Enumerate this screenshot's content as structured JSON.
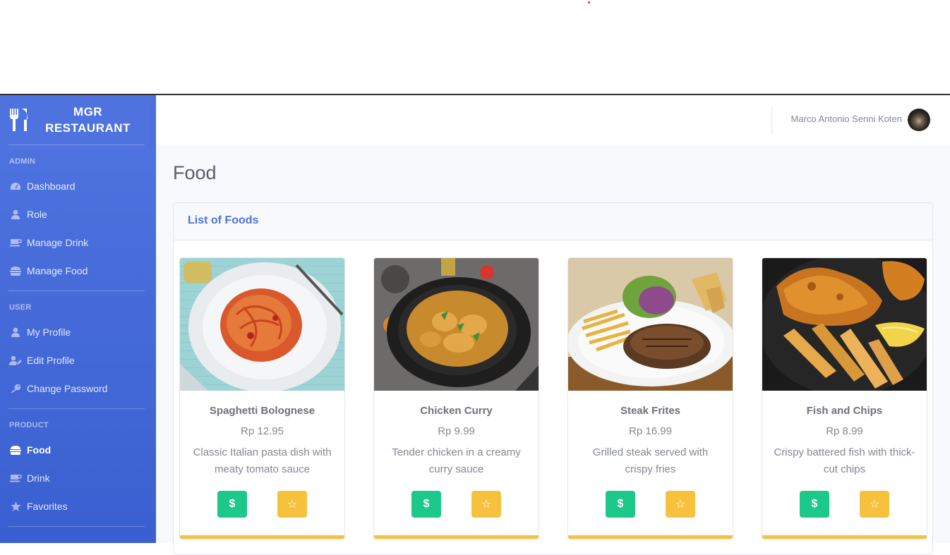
{
  "brand": {
    "line1": "MGR",
    "line2": "RESTAURANT",
    "icon": "utensils-icon"
  },
  "sidebar": {
    "sections": [
      {
        "heading": "ADMIN",
        "items": [
          {
            "label": "Dashboard",
            "icon": "tachometer-icon"
          },
          {
            "label": "Role",
            "icon": "user-icon"
          },
          {
            "label": "Manage Drink",
            "icon": "mug-icon"
          },
          {
            "label": "Manage Food",
            "icon": "hamburger-icon"
          }
        ]
      },
      {
        "heading": "USER",
        "items": [
          {
            "label": "My Profile",
            "icon": "user-icon"
          },
          {
            "label": "Edit Profile",
            "icon": "user-edit-icon"
          },
          {
            "label": "Change Password",
            "icon": "key-icon"
          }
        ]
      },
      {
        "heading": "PRODUCT",
        "items": [
          {
            "label": "Food",
            "icon": "hamburger-icon",
            "active": true
          },
          {
            "label": "Drink",
            "icon": "mug-icon"
          },
          {
            "label": "Favorites",
            "icon": "star-icon"
          }
        ]
      }
    ]
  },
  "topbar": {
    "user_name": "Marco Antonio Senni Koten"
  },
  "page": {
    "title": "Food",
    "card_title": "List of Foods"
  },
  "foods": [
    {
      "name": "Spaghetti Bolognese",
      "price": "Rp 12.95",
      "desc": "Classic Italian pasta dish with meaty tomato sauce",
      "buy": "$",
      "fav": "☆"
    },
    {
      "name": "Chicken Curry",
      "price": "Rp 9.99",
      "desc": "Tender chicken in a creamy curry sauce",
      "buy": "$",
      "fav": "☆"
    },
    {
      "name": "Steak Frites",
      "price": "Rp 16.99",
      "desc": "Grilled steak served with crispy fries",
      "buy": "$",
      "fav": "☆"
    },
    {
      "name": "Fish and Chips",
      "price": "Rp 8.99",
      "desc": "Crispy battered fish with thick-cut chips",
      "buy": "$",
      "fav": "☆"
    }
  ],
  "colors": {
    "primary": "#4e73df",
    "success": "#1cc88a",
    "warning": "#f6c23e"
  }
}
